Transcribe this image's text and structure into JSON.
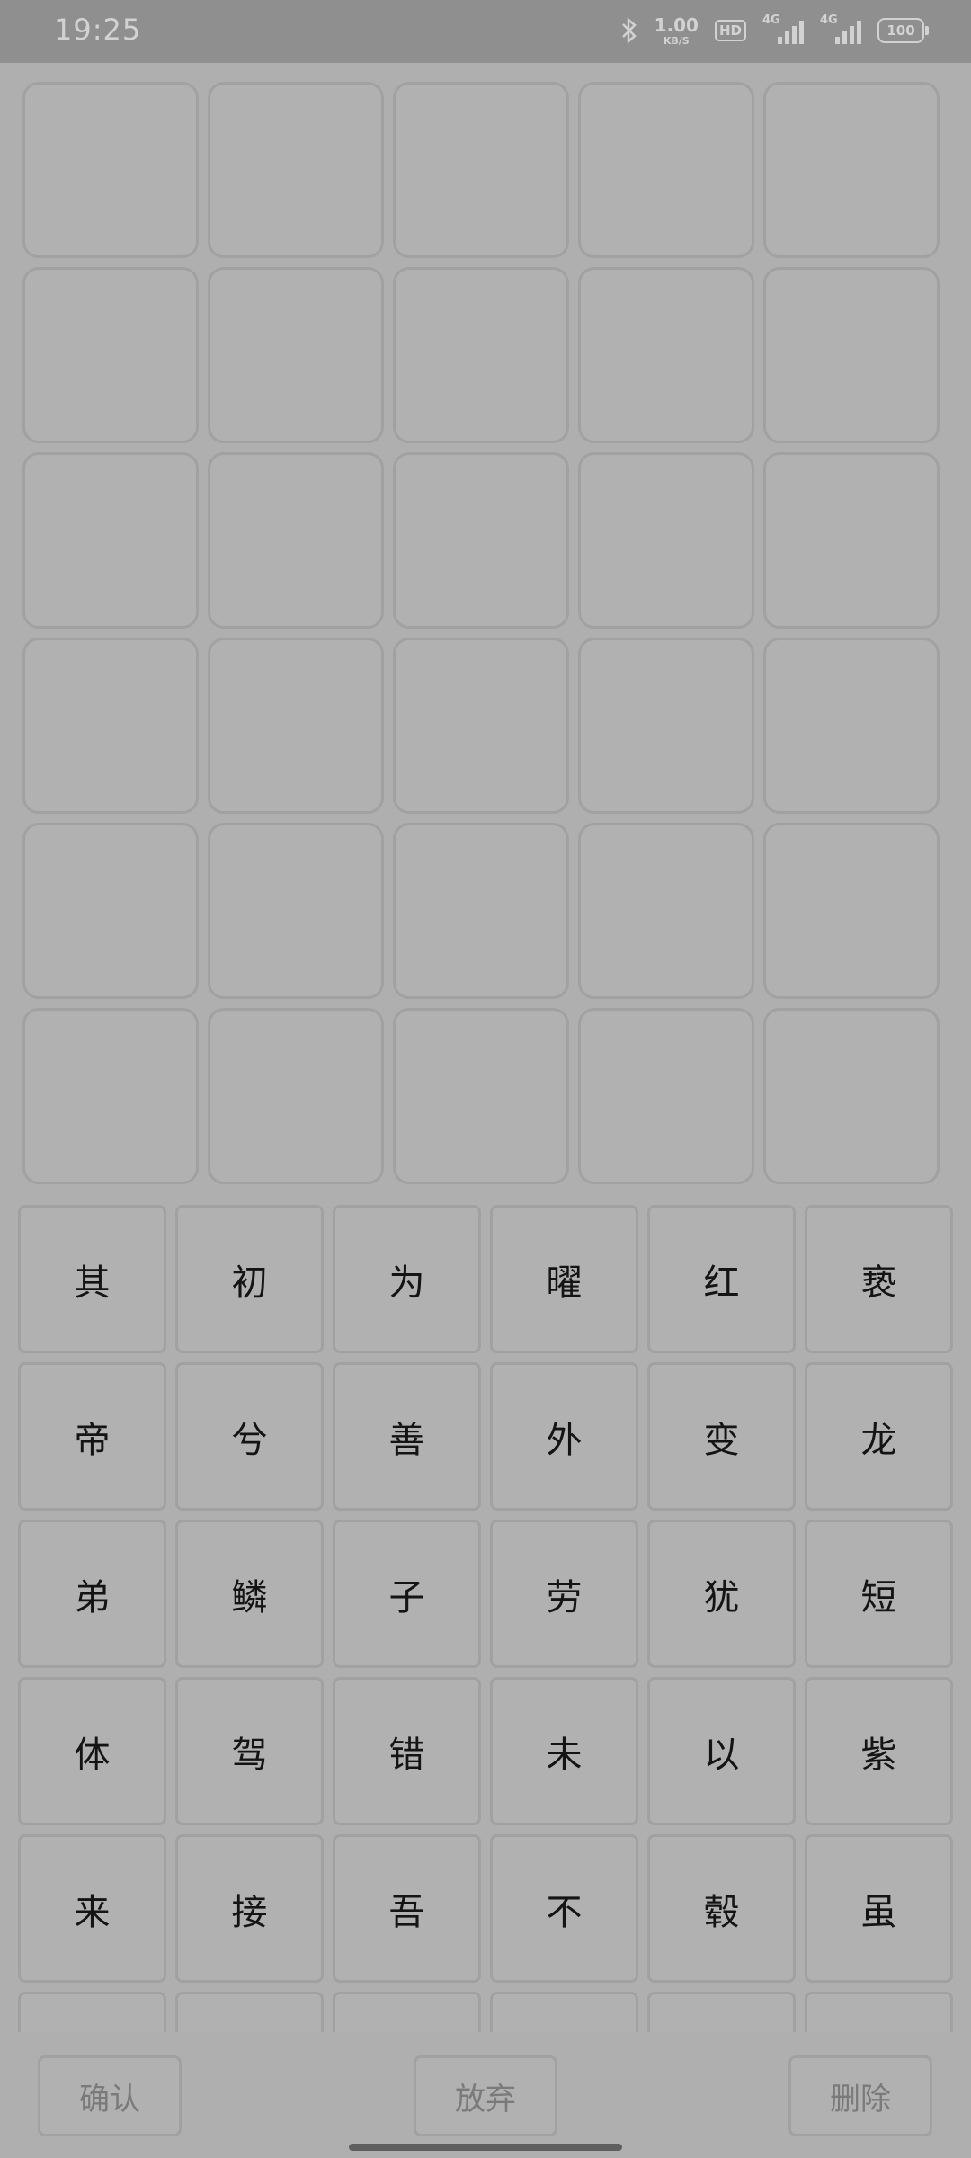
{
  "status_bar": {
    "time": "19:25",
    "speed_value": "1.00",
    "speed_unit": "KB/S",
    "hd_label": "HD",
    "net1_label": "4G",
    "net2_label": "4G",
    "battery": "100",
    "icons": [
      "bluetooth-icon",
      "signal-icon",
      "signal-icon",
      "battery-icon"
    ]
  },
  "answer_grid": {
    "rows": 6,
    "cols": 5,
    "cells": [
      "",
      "",
      "",
      "",
      "",
      "",
      "",
      "",
      "",
      "",
      "",
      "",
      "",
      "",
      "",
      "",
      "",
      "",
      "",
      "",
      "",
      "",
      "",
      "",
      "",
      "",
      "",
      "",
      "",
      ""
    ]
  },
  "keyboard": {
    "cols": 6,
    "keys": [
      "其",
      "初",
      "为",
      "曜",
      "红",
      "亵",
      "帝",
      "兮",
      "善",
      "外",
      "变",
      "龙",
      "弟",
      "鳞",
      "子",
      "劳",
      "犹",
      "短",
      "体",
      "驾",
      "错",
      "未",
      "以",
      "紫",
      "来",
      "接",
      "吾",
      "不",
      "毂",
      "虽",
      "",
      "",
      "",
      "",
      "",
      ""
    ]
  },
  "actions": {
    "confirm": "确认",
    "give_up": "放弃",
    "delete": "删除"
  },
  "colors": {
    "background": "#afafaf",
    "status_bar": "#8f8f8f",
    "cell_border": "#a1a1a1",
    "key_text": "#141414",
    "button_text": "#7a7a7a"
  }
}
